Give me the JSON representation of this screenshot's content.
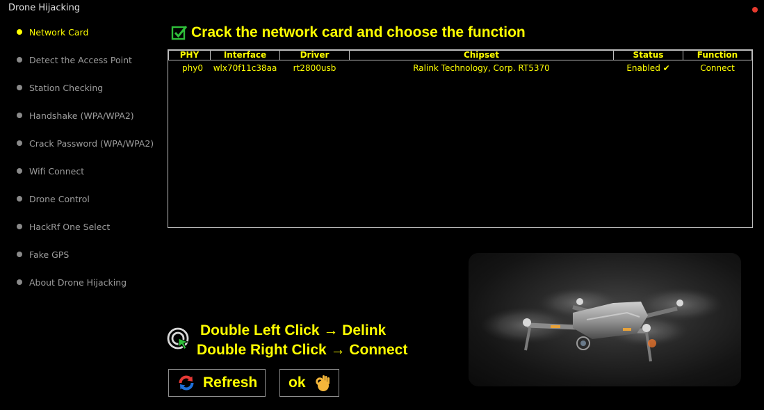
{
  "window": {
    "title": "Drone Hijacking",
    "close_color": "#e63a2e"
  },
  "sidebar": {
    "items": [
      {
        "label": "Network Card",
        "active": true
      },
      {
        "label": "Detect the Access Point",
        "active": false
      },
      {
        "label": "Station Checking",
        "active": false
      },
      {
        "label": "Handshake (WPA/WPA2)",
        "active": false
      },
      {
        "label": "Crack Password (WPA/WPA2)",
        "active": false
      },
      {
        "label": "Wifi Connect",
        "active": false
      },
      {
        "label": "Drone Control",
        "active": false
      },
      {
        "label": "HackRf One Select",
        "active": false
      },
      {
        "label": "Fake GPS",
        "active": false
      },
      {
        "label": "About Drone Hijacking",
        "active": false
      }
    ]
  },
  "header": {
    "icon": "checkbox-check-icon",
    "title": "Crack the network card and choose the function"
  },
  "table": {
    "columns": [
      "PHY",
      "Interface",
      "Driver",
      "Chipset",
      "Status",
      "Function"
    ],
    "rows": [
      [
        "phy0",
        "wlx70f11c38aa",
        "rt2800usb",
        "Ralink Technology, Corp. RT5370",
        "Enabled ✔",
        "Connect"
      ]
    ]
  },
  "hints": {
    "icon": "click-target-icon",
    "line1": "Double Left Click → Delink",
    "line2": "Double Right Click → Connect"
  },
  "buttons": {
    "refresh": {
      "label": "Refresh",
      "icon": "refresh-icon"
    },
    "ok": {
      "label": "ok",
      "icon": "ok-hand-icon"
    }
  },
  "colors": {
    "accent": "#ffff00",
    "background": "#000000",
    "sidebar_text": "#9c9c9c"
  }
}
